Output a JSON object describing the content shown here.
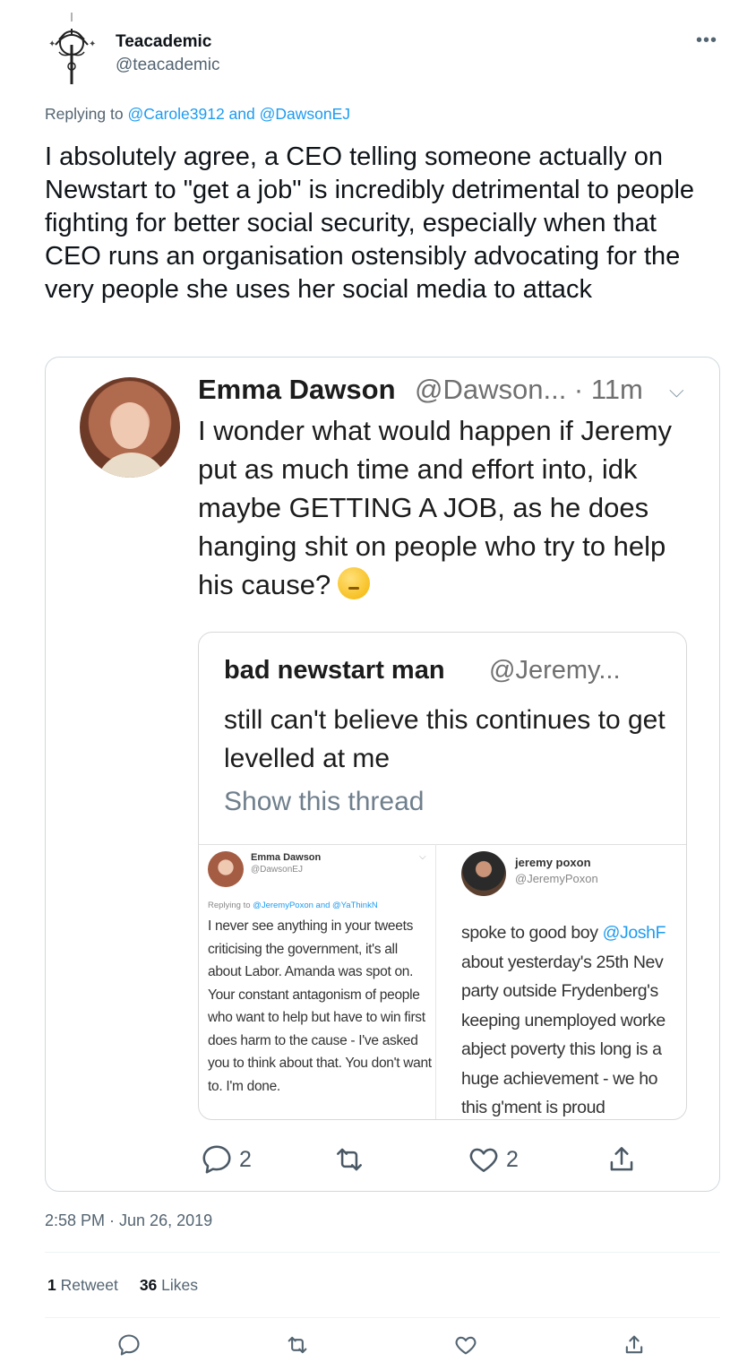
{
  "tweet": {
    "display_name": "Teacademic",
    "handle": "@teacademic",
    "more_icon": "more-horizontal-icon",
    "replying_prefix": "Replying to",
    "replying_to": "@Carole3912 and @DawsonEJ",
    "text": "I absolutely agree, a CEO telling someone actually on Newstart to \"get a job\" is incredibly detrimental to people fighting for better social security, especially when that CEO runs an organisation ostensibly advocating for the very people she uses her social media to attack",
    "timestamp": "2:58 PM · Jun 26, 2019",
    "stats": {
      "retweets_count": "1",
      "retweets_label": "Retweet",
      "likes_count": "36",
      "likes_label": "Likes"
    }
  },
  "screenshot": {
    "author_name": "Emma Dawson",
    "author_meta": "@Dawson... · 11m",
    "text": "I wonder what would happen if Jeremy put as much time and effort into, idk maybe GETTING A JOB, as he does hanging shit on people who try to help his cause?",
    "emoji": "thinking-face-emoji",
    "quoted": {
      "author_name": "bad newstart man",
      "author_handle": "@Jeremy...",
      "text": "still can't believe this continues to get levelled at me",
      "show_thread": "Show this thread",
      "left_card": {
        "name": "Emma Dawson",
        "handle": "@DawsonEJ",
        "replying_prefix": "Replying to",
        "replying_to": "@JeremyPoxon and @YaThinkN",
        "text": "I never see anything in your tweets criticising the government, it's all about Labor. Amanda was spot on. Your constant antagonism of people who want to help but have to win first does harm to the cause - I've asked you to think about that. You don't want to. I'm done."
      },
      "right_card": {
        "name": "jeremy poxon",
        "handle": "@JeremyPoxon",
        "lines": [
          "spoke to good boy ",
          "about yesterday's 25th Nev",
          "party outside Frydenberg's",
          "keeping unemployed worke",
          "abject poverty this long is a",
          "huge achievement - we ho",
          "this g'ment is proud"
        ],
        "mention": "@JoshF"
      }
    },
    "actions": {
      "reply_count": "2",
      "like_count": "2"
    }
  },
  "colors": {
    "accent": "#1d9bf0",
    "secondary_text": "#536471",
    "border": "#cfd9de"
  }
}
